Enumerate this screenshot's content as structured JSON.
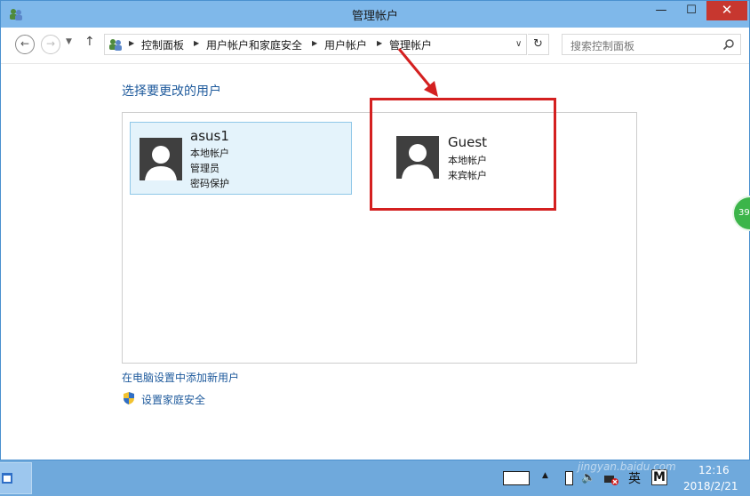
{
  "window": {
    "title": "管理帐户",
    "min_glyph": "—",
    "max_glyph": "☐",
    "close_glyph": "✕"
  },
  "nav": {
    "back_glyph": "←",
    "forward_glyph": "→",
    "history_glyph": "▼",
    "up_glyph": "↑",
    "breadcrumbs": [
      "控制面板",
      "用户帐户和家庭安全",
      "用户帐户",
      "管理帐户"
    ],
    "separator_glyph": "▶",
    "address_dropdown_glyph": "∨",
    "refresh_glyph": "↻",
    "search_placeholder": "搜索控制面板"
  },
  "main": {
    "heading": "选择要更改的用户",
    "users": [
      {
        "name": "asus1",
        "lines": [
          "本地帐户",
          "管理员",
          "密码保护"
        ],
        "selected": true
      },
      {
        "name": "Guest",
        "lines": [
          "本地帐户",
          "来宾帐户"
        ],
        "selected": false,
        "highlighted": true
      }
    ],
    "link_add_user": "在电脑设置中添加新用户",
    "link_family_safety": "设置家庭安全"
  },
  "side_badge": "39",
  "taskbar": {
    "tray_arrow_glyph": "▲",
    "volume_glyph": "🔈",
    "ime_label": "英",
    "m_label": "M",
    "time": "12:16",
    "date": "2018/2/21"
  },
  "watermark": {
    "text": "jingyan.baidu.com"
  },
  "colors": {
    "titlebar": "#7fb8ea",
    "close_button": "#c7372f",
    "link": "#1e5a9c",
    "annotation_red": "#d42020",
    "selected_tile_bg": "#e4f3fb",
    "taskbar": "#6fa9dc"
  }
}
